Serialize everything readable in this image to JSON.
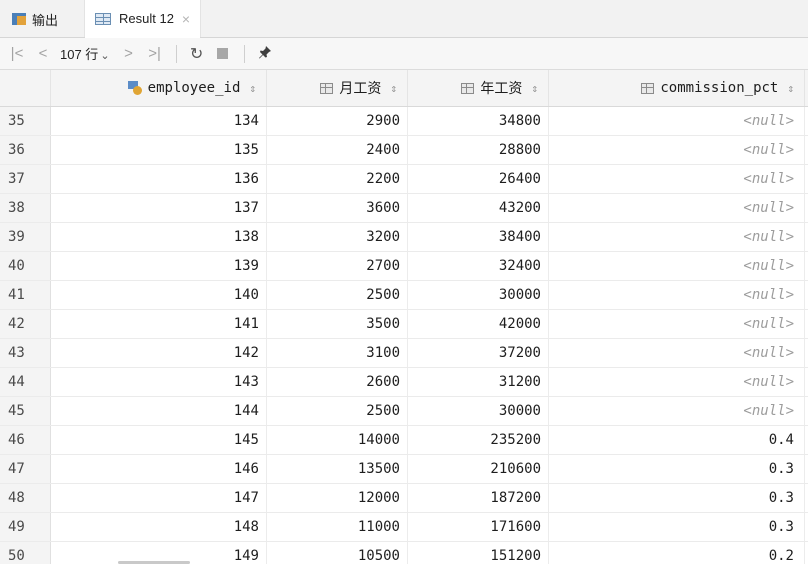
{
  "tabs": {
    "output_label": "输出",
    "result_label": "Result 12",
    "close_glyph": "×"
  },
  "toolbar": {
    "first_glyph": "|<",
    "prev_glyph": "<",
    "rows_label": "107 行",
    "rows_chevron": "⌄",
    "next_glyph": ">",
    "last_glyph": ">|",
    "refresh_glyph": "↻",
    "pin_glyph": "📌"
  },
  "columns": [
    {
      "label": "employee_id",
      "icon": "primary-key-icon"
    },
    {
      "label": "月工资",
      "icon": "column-icon"
    },
    {
      "label": "年工资",
      "icon": "column-icon"
    },
    {
      "label": "commission_pct",
      "icon": "column-icon"
    }
  ],
  "sort_glyph": "⇕",
  "rows": [
    {
      "n": "35",
      "employee_id": "134",
      "monthly": "2900",
      "annual": "34800",
      "commission": "<null>"
    },
    {
      "n": "36",
      "employee_id": "135",
      "monthly": "2400",
      "annual": "28800",
      "commission": "<null>"
    },
    {
      "n": "37",
      "employee_id": "136",
      "monthly": "2200",
      "annual": "26400",
      "commission": "<null>"
    },
    {
      "n": "38",
      "employee_id": "137",
      "monthly": "3600",
      "annual": "43200",
      "commission": "<null>"
    },
    {
      "n": "39",
      "employee_id": "138",
      "monthly": "3200",
      "annual": "38400",
      "commission": "<null>"
    },
    {
      "n": "40",
      "employee_id": "139",
      "monthly": "2700",
      "annual": "32400",
      "commission": "<null>"
    },
    {
      "n": "41",
      "employee_id": "140",
      "monthly": "2500",
      "annual": "30000",
      "commission": "<null>"
    },
    {
      "n": "42",
      "employee_id": "141",
      "monthly": "3500",
      "annual": "42000",
      "commission": "<null>"
    },
    {
      "n": "43",
      "employee_id": "142",
      "monthly": "3100",
      "annual": "37200",
      "commission": "<null>"
    },
    {
      "n": "44",
      "employee_id": "143",
      "monthly": "2600",
      "annual": "31200",
      "commission": "<null>"
    },
    {
      "n": "45",
      "employee_id": "144",
      "monthly": "2500",
      "annual": "30000",
      "commission": "<null>"
    },
    {
      "n": "46",
      "employee_id": "145",
      "monthly": "14000",
      "annual": "235200",
      "commission": "0.4"
    },
    {
      "n": "47",
      "employee_id": "146",
      "monthly": "13500",
      "annual": "210600",
      "commission": "0.3"
    },
    {
      "n": "48",
      "employee_id": "147",
      "monthly": "12000",
      "annual": "187200",
      "commission": "0.3"
    },
    {
      "n": "49",
      "employee_id": "148",
      "monthly": "11000",
      "annual": "171600",
      "commission": "0.3"
    },
    {
      "n": "50",
      "employee_id": "149",
      "monthly": "10500",
      "annual": "151200",
      "commission": "0.2"
    }
  ]
}
